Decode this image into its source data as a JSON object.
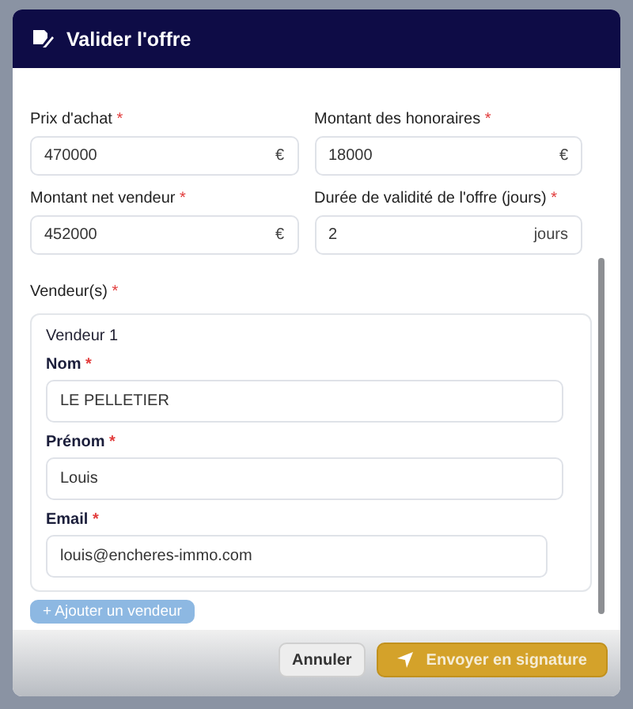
{
  "dialog": {
    "title": "Valider l'offre"
  },
  "fields": [
    {
      "label": "Prix d'achat",
      "mark": "*",
      "value": "470000",
      "suffix": "€"
    },
    {
      "label": "Montant des honoraires",
      "mark": "*",
      "value": "18000",
      "suffix": "€"
    },
    {
      "label": "Montant net vendeur",
      "mark": "*",
      "value": "452000",
      "suffix": "€"
    },
    {
      "label": "Durée de validité de l'offre (jours)",
      "mark": "*",
      "value": "2",
      "suffix": "jours"
    }
  ],
  "sellers_section": {
    "label": "Vendeur(s)",
    "mark": "*"
  },
  "sellers": [
    {
      "title": "Vendeur 1",
      "fields": [
        {
          "label": "Nom",
          "mark": "*",
          "value": "LE PELLETIER"
        },
        {
          "label": "Prénom",
          "mark": "*",
          "value": "Louis"
        },
        {
          "label": "Email",
          "mark": "*",
          "value": "louis@encheres-immo.com"
        }
      ]
    }
  ],
  "add_seller_button": {
    "label": "Ajouter un vendeur",
    "icon": "+"
  },
  "buttons": [
    {
      "label": "Annuler",
      "kind": "secondary"
    },
    {
      "label": "Envoyer en signature",
      "kind": "primary"
    }
  ]
}
